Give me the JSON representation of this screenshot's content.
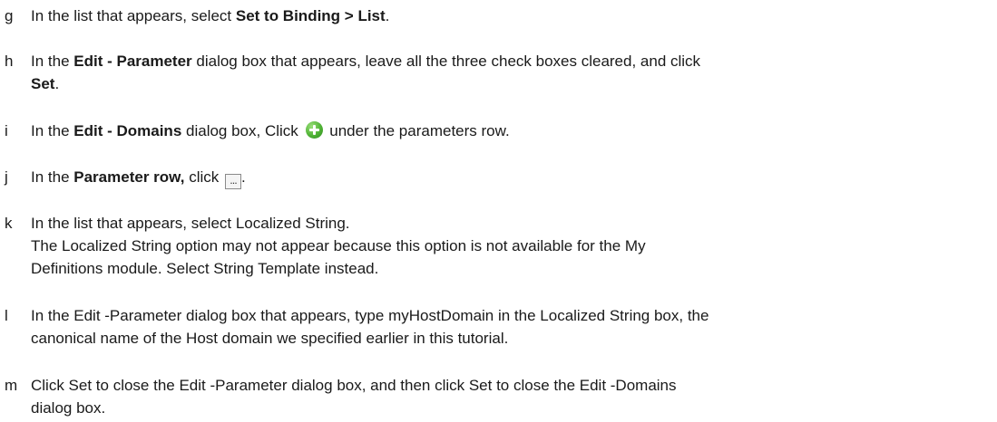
{
  "steps": [
    {
      "letter": "g",
      "t1": "In the list that appears, select ",
      "b1": "Set to Binding > List",
      "t2": "."
    },
    {
      "letter": "h",
      "t1": "In the ",
      "b1": "Edit - Parameter",
      "t2": " dialog box that appears, leave all the three check boxes cleared, and click",
      "b2": "Set",
      "t3": "."
    },
    {
      "letter": "i",
      "t1": "In the ",
      "b1": "Edit - Domains",
      "t2": " dialog box, Click ",
      "icon": "green-plus-icon",
      "t3": " under the parameters row."
    },
    {
      "letter": "j",
      "t1": "In the ",
      "b1": "Parameter row,",
      "t2": " click ",
      "icon": "ellipsis-button-icon",
      "icon_text": "...",
      "t3": "."
    },
    {
      "letter": "k",
      "line1": "In the list that appears, select Localized String.",
      "line2": "The Localized String option may not appear because this option is not available for the My",
      "line3": "Definitions module. Select String Template instead."
    },
    {
      "letter": "l",
      "line1": "In the Edit -Parameter dialog box that appears, type myHostDomain in the Localized String box, the",
      "line2": "canonical name of the Host domain we specified earlier in this tutorial."
    },
    {
      "letter": "m",
      "line1": "Click Set to close the Edit -Parameter dialog box, and then click Set to close the Edit -Domains",
      "line2": "dialog box."
    }
  ]
}
